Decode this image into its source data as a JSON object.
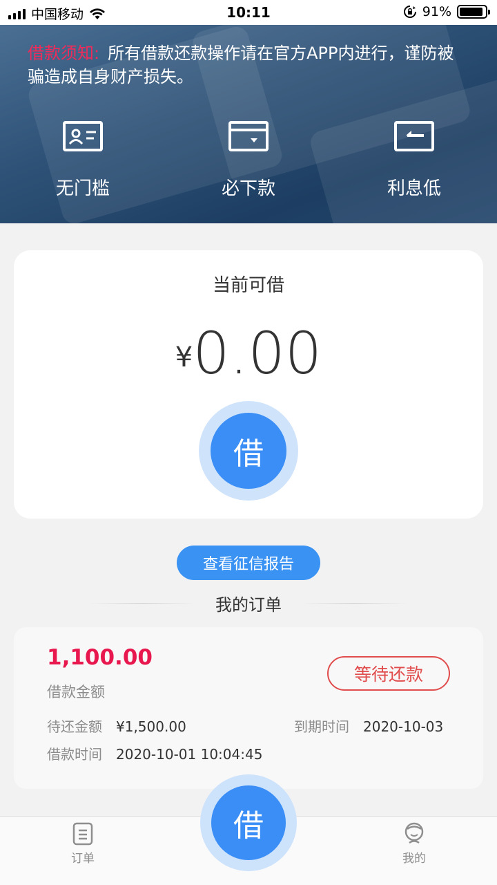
{
  "status_bar": {
    "carrier": "中国移动",
    "time": "10:11",
    "battery_percent": "91%",
    "battery_level": 0.91,
    "icons": [
      "signal-icon",
      "wifi-icon",
      "rotation-lock-icon",
      "battery-icon"
    ]
  },
  "banner": {
    "notice_tag": "借款须知:",
    "notice_text": "所有借款还款操作请在官方APP内进行，谨防被骗造成自身财产损失。",
    "features": [
      {
        "label": "无门槛",
        "icon": "id-card-icon"
      },
      {
        "label": "必下款",
        "icon": "wallet-icon"
      },
      {
        "label": "利息低",
        "icon": "return-arrow-icon"
      }
    ]
  },
  "borrow_card": {
    "label": "当前可借",
    "currency": "¥",
    "amount": "0.00",
    "button_label": "借"
  },
  "credit_report_button": "查看征信报告",
  "orders": {
    "title": "我的订单",
    "items": [
      {
        "amount": "1,100.00",
        "amount_label": "借款金额",
        "status": "等待还款",
        "due_amount_label": "待还金额",
        "due_amount": "¥1,500.00",
        "due_date_label": "到期时间",
        "due_date": "2020-10-03",
        "loan_time_label": "借款时间",
        "loan_time": "2020-10-01 10:04:45"
      }
    ]
  },
  "tabbar": {
    "orders_label": "订单",
    "center_label": "借",
    "mine_label": "我的"
  },
  "colors": {
    "accent_blue": "#3a8ef6",
    "alert_red": "#e8184f",
    "status_red": "#e14c4c"
  }
}
